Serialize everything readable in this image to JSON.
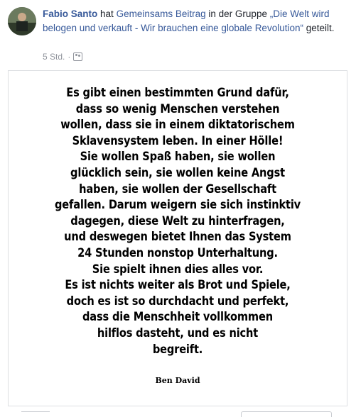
{
  "post": {
    "author": "Fabio Santo",
    "text_hat": "hat",
    "shared_owner": "Gemeinsams",
    "shared_type": "Beitrag",
    "text_in_group": "in der Gruppe",
    "group_name": "„Die Welt wird belogen und verkauft - Wir brauchen eine globale Revolution“",
    "text_shared": "geteilt.",
    "time": "5 Std.",
    "separator": "·",
    "audience_icon": "group-audience-icon"
  },
  "image": {
    "quote_lines": [
      "Es gibt einen bestimmten Grund dafür,",
      "dass so wenig Menschen verstehen",
      "wollen, dass sie in einem diktatorischem",
      "Sklavensystem leben. In einer Hölle!",
      "Sie wollen Spaß haben, sie wollen",
      "glücklich sein, sie wollen keine Angst",
      "haben, sie wollen der Gesellschaft",
      "gefallen. Darum weigern sie sich instinktiv",
      "dagegen, diese Welt zu hinterfragen,",
      "und deswegen bietet Ihnen das System",
      "24 Stunden nonstop Unterhaltung.",
      "Sie spielt ihnen dies alles vor.",
      "Es ist nichts weiter als Brot und Spiele,",
      "doch es ist so durchdacht und perfekt,",
      "dass die Menschheit vollkommen",
      "hilflos dasteht, und es nicht",
      "begreift."
    ],
    "quote_author": "Ben David"
  },
  "colors": {
    "link": "#365899",
    "text": "#1d2129",
    "meta": "#90949c",
    "border": "#dddfe2"
  }
}
